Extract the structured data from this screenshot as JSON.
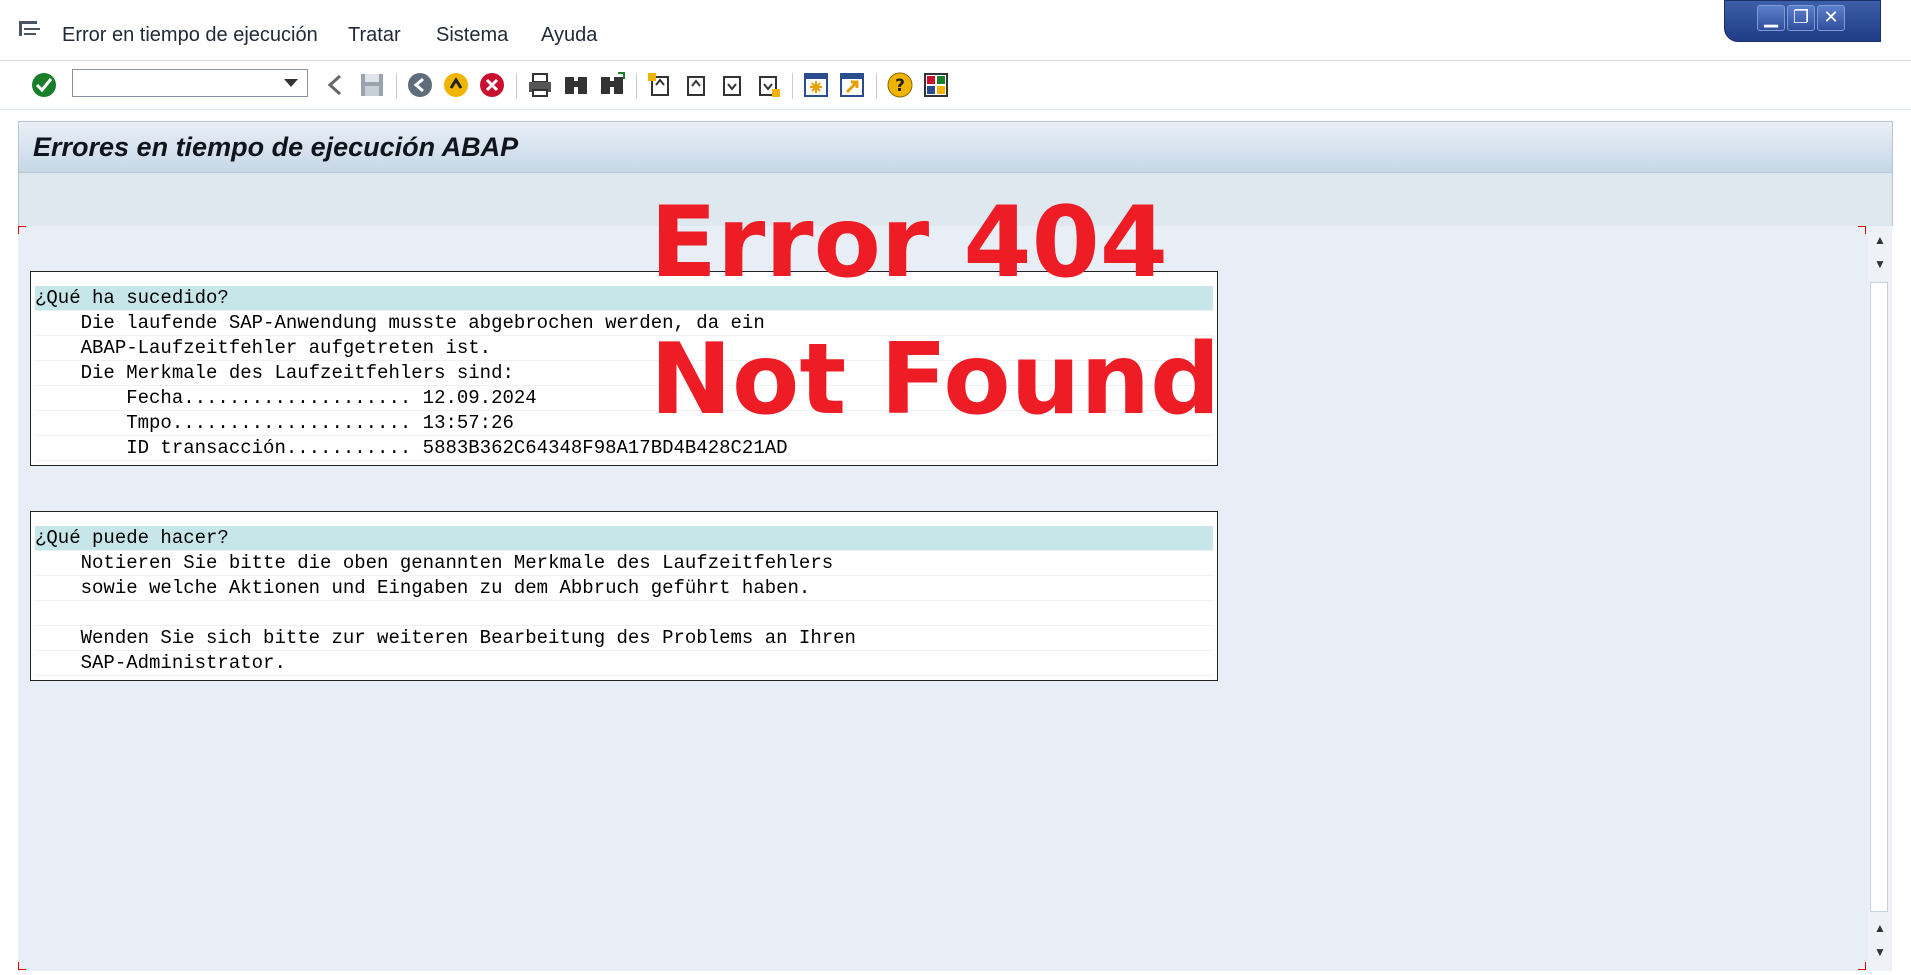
{
  "menu": {
    "items": [
      "Error en tiempo de ejecución",
      "Tratar",
      "Sistema",
      "Ayuda"
    ]
  },
  "window_controls": {
    "minimize": "▁",
    "restore": "❐",
    "close": "✕"
  },
  "toolbar": {
    "command_field_value": "",
    "icons": [
      "enter-icon",
      "back-icon",
      "save-icon",
      "back-nav-icon",
      "exit-icon",
      "cancel-icon",
      "print-icon",
      "find-icon",
      "find-next-icon",
      "first-page-icon",
      "prev-page-icon",
      "next-page-icon",
      "last-page-icon",
      "create-session-icon",
      "shortcut-icon",
      "help-icon",
      "customize-layout-icon"
    ]
  },
  "page": {
    "title": "Errores en tiempo de ejecución ABAP"
  },
  "overlay": {
    "line1": "Error 404",
    "line2": "Not Found",
    "color": "#ee1c25"
  },
  "panel1": {
    "rows": [
      "¿Qué ha sucedido?",
      "    Die laufende SAP-Anwendung musste abgebrochen werden, da ein",
      "    ABAP-Laufzeitfehler aufgetreten ist.",
      "    Die Merkmale des Laufzeitfehlers sind:",
      "        Fecha.................... 12.09.2024",
      "        Tmpo..................... 13:57:26",
      "        ID transacción........... 5883B362C64348F98A17BD4B428C21AD"
    ]
  },
  "panel2": {
    "rows": [
      "¿Qué puede hacer?",
      "    Notieren Sie bitte die oben genannten Merkmale des Laufzeitfehlers",
      "    sowie welche Aktionen und Eingaben zu dem Abbruch geführt haben.",
      "",
      "    Wenden Sie sich bitte zur weiteren Bearbeitung des Problems an Ihren",
      "    SAP-Administrator."
    ]
  },
  "colors": {
    "panel_header": "#c7e6ea",
    "content_bg": "#e7eef5",
    "title_bar": "#c7d7e6",
    "window_ctrl": "#1f3c86"
  }
}
